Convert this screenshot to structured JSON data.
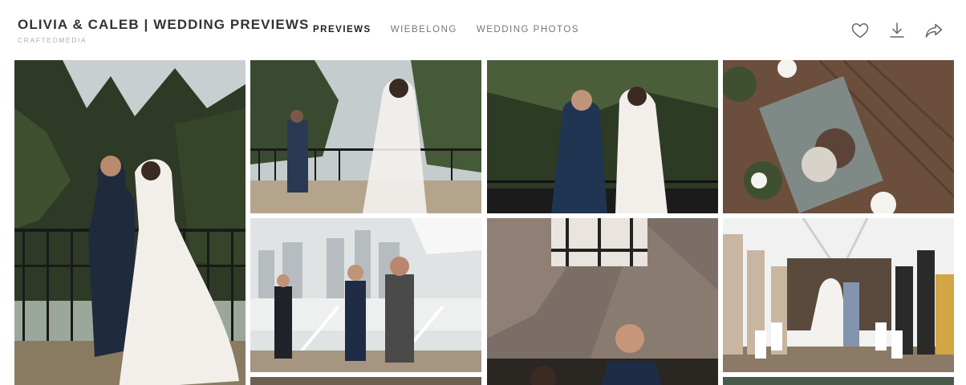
{
  "gallery": {
    "title": "OLIVIA & CALEB | WEDDING PREVIEWS",
    "subtitle": "CRAFTEDMEDIA"
  },
  "nav": {
    "items": [
      {
        "label": "PREVIEWS",
        "active": true
      },
      {
        "label": "WIEBELONG",
        "active": false
      },
      {
        "label": "WEDDING PHOTOS",
        "active": false
      }
    ]
  },
  "actions": {
    "icons": [
      "heart-icon",
      "download-icon",
      "share-icon"
    ]
  },
  "photos": [
    "couple-railing-tall",
    "bride-veil-groom-railing",
    "couple-first-look",
    "invitation-flowers",
    "officiant-ceremony",
    "tudor-roof-groom",
    "aisle-walk"
  ]
}
